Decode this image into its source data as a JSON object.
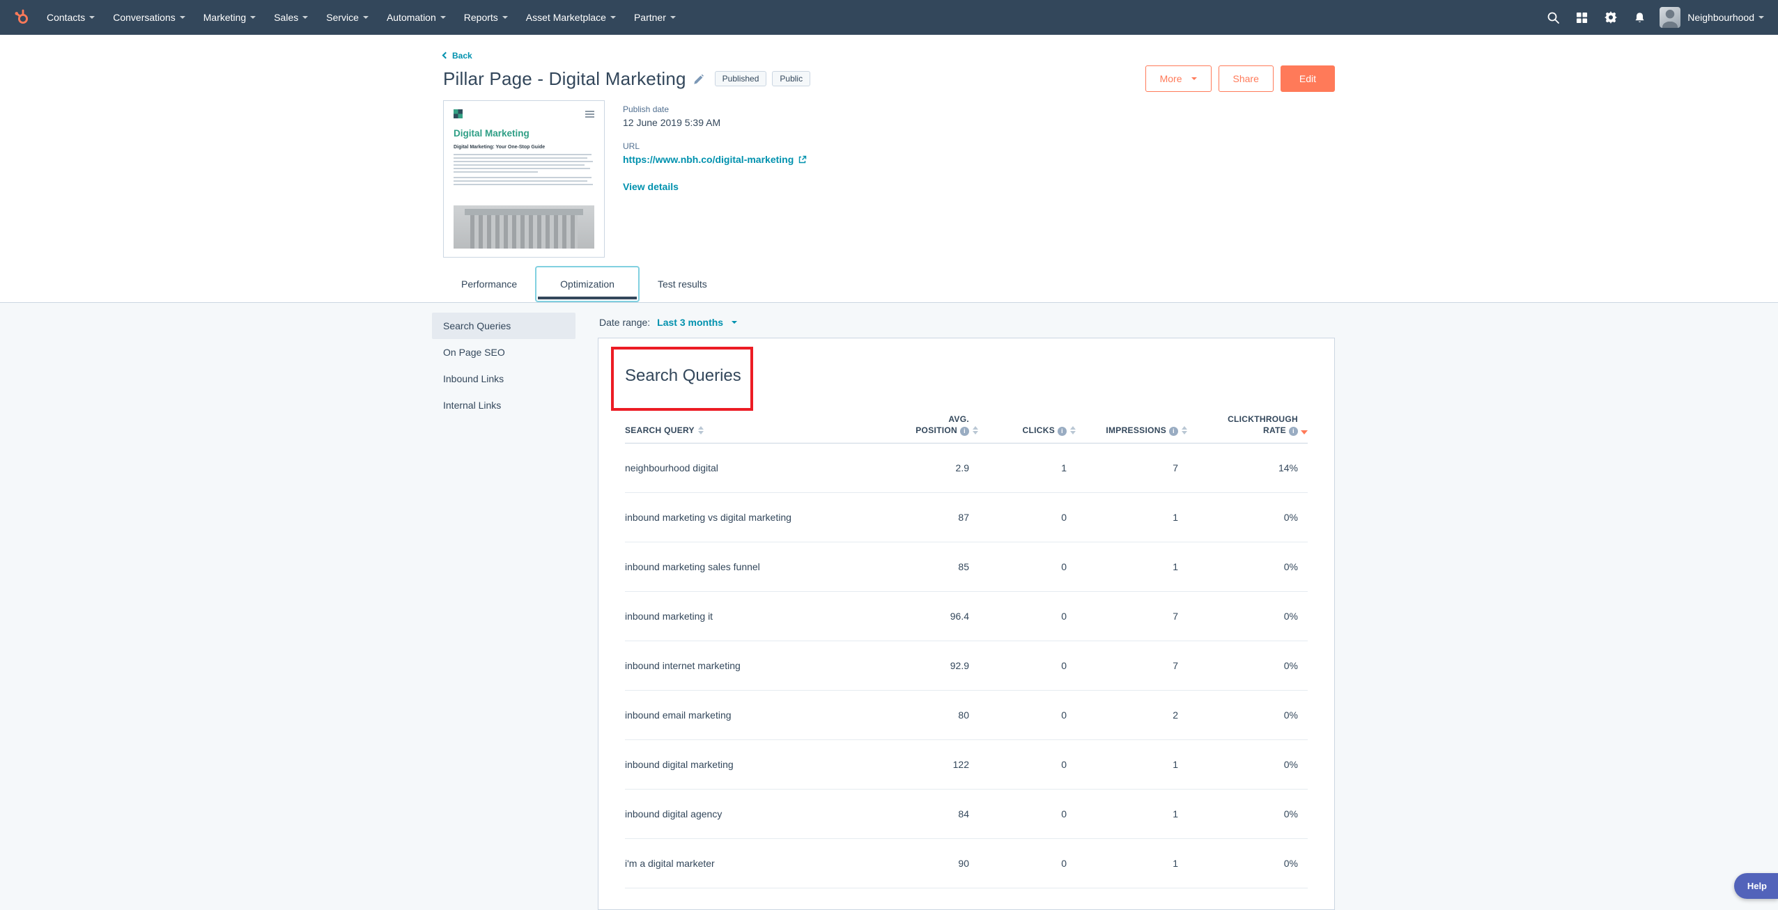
{
  "navbar": {
    "items": [
      {
        "label": "Contacts"
      },
      {
        "label": "Conversations"
      },
      {
        "label": "Marketing"
      },
      {
        "label": "Sales"
      },
      {
        "label": "Service"
      },
      {
        "label": "Automation"
      },
      {
        "label": "Reports"
      },
      {
        "label": "Asset Marketplace"
      },
      {
        "label": "Partner"
      }
    ],
    "account_name": "Neighbourhood"
  },
  "icons": {
    "navbar": [
      "hubspot-sprocket-icon",
      "search-icon",
      "marketplace-icon",
      "settings-icon",
      "notifications-icon",
      "caret-down-icon"
    ],
    "content": [
      "edit-pencil-icon",
      "external-link-icon",
      "info-icon",
      "sort-carets-icon",
      "back-chevron-icon"
    ]
  },
  "header": {
    "back_label": "Back",
    "title": "Pillar Page - Digital Marketing",
    "badges": [
      "Published",
      "Public"
    ],
    "more_label": "More",
    "share_label": "Share",
    "edit_label": "Edit",
    "publish_date_label": "Publish date",
    "publish_date_value": "12 June 2019 5:39 AM",
    "url_label": "URL",
    "url_value": "https://www.nbh.co/digital-marketing",
    "view_details_label": "View details"
  },
  "thumbnail": {
    "doc_title": "Digital Marketing",
    "doc_subtitle": "Digital Marketing: Your One-Stop Guide"
  },
  "tabs": [
    {
      "label": "Performance",
      "active": false
    },
    {
      "label": "Optimization",
      "active": true
    },
    {
      "label": "Test results",
      "active": false
    }
  ],
  "sidebar": {
    "items": [
      {
        "label": "Search Queries",
        "active": true
      },
      {
        "label": "On Page SEO",
        "active": false
      },
      {
        "label": "Inbound Links",
        "active": false
      },
      {
        "label": "Internal Links",
        "active": false
      }
    ]
  },
  "filters": {
    "date_range_label": "Date range:",
    "date_range_value": "Last 3 months"
  },
  "card": {
    "heading": "Search Queries",
    "table": {
      "columns": [
        "SEARCH QUERY",
        "AVG. POSITION",
        "CLICKS",
        "IMPRESSIONS",
        "CLICKTHROUGH RATE"
      ],
      "sorted_by": "CLICKTHROUGH RATE",
      "sort_direction": "desc",
      "rows": [
        {
          "query": "neighbourhood digital",
          "avg_position": "2.9",
          "clicks": "1",
          "impressions": "7",
          "ctr": "14%"
        },
        {
          "query": "inbound marketing vs digital marketing",
          "avg_position": "87",
          "clicks": "0",
          "impressions": "1",
          "ctr": "0%"
        },
        {
          "query": "inbound marketing sales funnel",
          "avg_position": "85",
          "clicks": "0",
          "impressions": "1",
          "ctr": "0%"
        },
        {
          "query": "inbound marketing it",
          "avg_position": "96.4",
          "clicks": "0",
          "impressions": "7",
          "ctr": "0%"
        },
        {
          "query": "inbound internet marketing",
          "avg_position": "92.9",
          "clicks": "0",
          "impressions": "7",
          "ctr": "0%"
        },
        {
          "query": "inbound email marketing",
          "avg_position": "80",
          "clicks": "0",
          "impressions": "2",
          "ctr": "0%"
        },
        {
          "query": "inbound digital marketing",
          "avg_position": "122",
          "clicks": "0",
          "impressions": "1",
          "ctr": "0%"
        },
        {
          "query": "inbound digital agency",
          "avg_position": "84",
          "clicks": "0",
          "impressions": "1",
          "ctr": "0%"
        },
        {
          "query": "i'm a digital marketer",
          "avg_position": "90",
          "clicks": "0",
          "impressions": "1",
          "ctr": "0%"
        }
      ]
    }
  },
  "help_label": "Help",
  "colors": {
    "navbar_bg": "#33475b",
    "accent_orange": "#ff7a59",
    "link_teal": "#0091ae",
    "annotation_red": "#ec1c24",
    "help_bg": "#5263ba"
  }
}
